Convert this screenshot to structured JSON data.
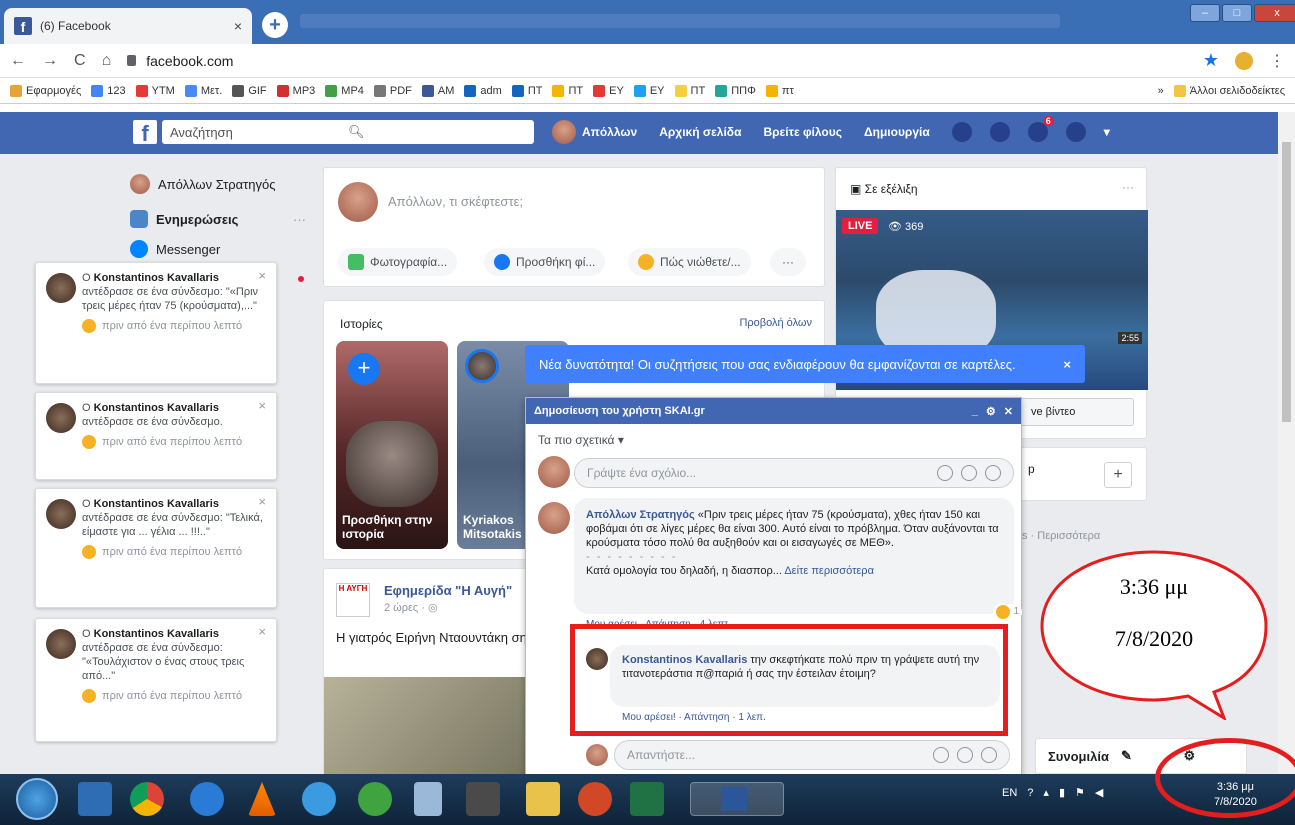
{
  "browser": {
    "tab_title": "(6) Facebook",
    "tab_close": "×",
    "new_tab": "+",
    "url": "facebook.com",
    "win_buttons": [
      "–",
      "□",
      "x"
    ],
    "bookmarks": [
      {
        "label": "Εφαρμογές",
        "color": "#e8a23a"
      },
      {
        "label": "123",
        "color": "#4285f4"
      },
      {
        "label": "YTM",
        "color": "#e53935"
      },
      {
        "label": "Μετ.",
        "color": "#4a8af4"
      },
      {
        "label": "GIF",
        "color": "#555555"
      },
      {
        "label": "MP3",
        "color": "#d32f2f"
      },
      {
        "label": "MP4",
        "color": "#43a047"
      },
      {
        "label": "PDF",
        "color": "#777777"
      },
      {
        "label": "AM",
        "color": "#3b5998"
      },
      {
        "label": "adm",
        "color": "#1565c0"
      },
      {
        "label": "ΠΤ",
        "color": "#1565c0"
      },
      {
        "label": "ΠΤ",
        "color": "#f4b400"
      },
      {
        "label": "ΕΥ",
        "color": "#e53935"
      },
      {
        "label": "ΕΥ",
        "color": "#1da1f2"
      },
      {
        "label": "ΠΤ",
        "color": "#f4d03f"
      },
      {
        "label": "ΠΠΦ",
        "color": "#26a69a"
      },
      {
        "label": "πτ",
        "color": "#f4b400"
      }
    ],
    "bookmarks_more": "»",
    "other_bookmarks": "Άλλοι σελιδοδείκτες"
  },
  "fb": {
    "search_placeholder": "Αναζήτηση",
    "profile_name": "Απόλλων",
    "nav": [
      "Αρχική σελίδα",
      "Βρείτε φίλους",
      "Δημιουργία"
    ],
    "notif_badge": "6"
  },
  "left": {
    "profile": "Απόλλων Στρατηγός",
    "updates": "Ενημερώσεις",
    "updates_more": "···",
    "messenger": "Messenger",
    "notifications": [
      {
        "name": "Konstantinos Kavallaris",
        "text": "αντέδρασε σε ένα σύνδεσμο: \"«Πριν τρεις μέρες ήταν 75 (κρούσματα),...\"",
        "time": "πριν από ένα περίπου λεπτό"
      },
      {
        "name": "Konstantinos Kavallaris",
        "text": "αντέδρασε σε ένα σύνδεσμο.",
        "time": "πριν από ένα περίπου λεπτό"
      },
      {
        "name": "Konstantinos Kavallaris",
        "text": "αντέδρασε σε ένα σύνδεσμο: \"Τελικά, είμαστε για ... γέλια ... !!!..\"",
        "time": "πριν από ένα περίπου λεπτό"
      },
      {
        "name": "Konstantinos Kavallaris",
        "text": "αντέδρασε σε ένα σύνδεσμο: \"«Τουλάχιστον ο ένας στους τρεις από...\"",
        "time": "πριν από ένα περίπου λεπτό"
      }
    ],
    "notif_prefix": "Ο",
    "notif_close": "×"
  },
  "composer": {
    "placeholder": "Απόλλων, τι σκέφτεστε;",
    "actions": [
      "Φωτογραφία...",
      "Προσθήκη φί...",
      "Πώς νιώθετε/...",
      "···"
    ]
  },
  "stories": {
    "title": "Ιστορίες",
    "view_all": "Προβολή όλων",
    "items": [
      "Προσθήκη στην ιστορία",
      "Kyriakos Mitsotakis"
    ]
  },
  "post": {
    "page": "Εφημερίδα \"Η Αυγή\"",
    "logo": "Η ΑΥΓΗ",
    "time": "2 ώρες · ◎",
    "text": "Η γιατρός Ειρήνη Νταουντάκη σηκώνει όλο το βάρος του κορ"
  },
  "live": {
    "title": "Σε εξέλιξη",
    "more": "···",
    "badge": "LIVE",
    "viewers": "369",
    "score": "2:55",
    "button": "ve βίντεο"
  },
  "right": {
    "card_text": "p",
    "card_plus": "+",
    "more": "s · Περισσότερα",
    "convo": "Συνομιλία"
  },
  "popup": {
    "tip": "Νέα δυνατότητα! Οι συζητήσεις που σας ενδιαφέρουν θα εμφανίζονται σε καρτέλες.",
    "tip_close": "×",
    "header": "Δημοσίευση του χρήστη SKAI.gr",
    "header_icons": [
      "_",
      "⚙",
      "✕"
    ],
    "relevance": "Τα πιο σχετικά ▾",
    "write_placeholder": "Γράψτε ένα σχόλιο...",
    "comment1_author": "Απόλλων Στρατηγός",
    "comment1_text": "«Πριν τρεις μέρες ήταν 75 (κρούσματα), χθες ήταν 150 και φοβάμαι ότι σε λίγες μέρες θα είναι 300. Αυτό είναι το πρόβλημα. Όταν αυξάνονται τα κρούσματα τόσο πολύ θα αυξηθούν και οι εισαγωγές σε ΜΕΘ».",
    "comment1_sep": "- - - - - - - - -",
    "comment1_more": "Κατά ομολογία του δηλαδή, η διασπορ...",
    "comment1_more_link": "Δείτε περισσότερα",
    "comment1_reacts": "1",
    "comment1_actions": "Μου αρέσει · Απάντηση · 4 λεπτ.",
    "comment2_author": "Konstantinos Kavallaris",
    "comment2_text": "την σκεφτήκατε πολύ πριν τη γράψετε αυτή την τιτανοτεράστια π@παριά ή σας την έστειλαν έτοιμη?",
    "comment2_actions": "Μου αρέσει! · Απάντηση · 1 λεπ.",
    "reply_placeholder": "Απαντήστε..."
  },
  "annotation": {
    "time": "3:36 μμ",
    "date": "7/8/2020",
    "color": "#e41e1e"
  },
  "taskbar": {
    "lang": "EN",
    "clock_time": "3:36 μμ",
    "clock_date": "7/8/2020"
  }
}
